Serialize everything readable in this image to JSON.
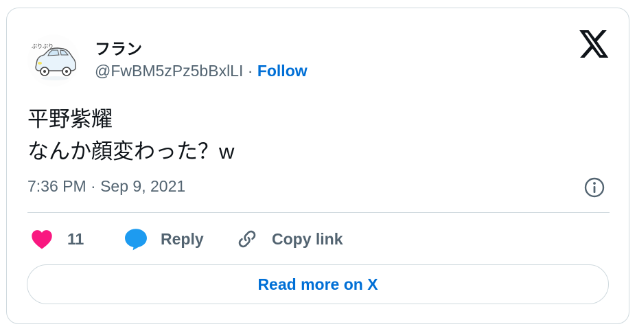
{
  "author": {
    "display_name": "フラン",
    "handle": "@FwBM5zPz5bBxlLI",
    "separator": " · ",
    "follow_label": "Follow",
    "avatar_icon": "car-drawing-avatar",
    "avatar_scribble": "ぷりぷり"
  },
  "tweet": {
    "line1": "平野紫耀",
    "line2": "なんか顔変わった？w",
    "timestamp": "7:36 PM · Sep 9, 2021"
  },
  "actions": {
    "like_count": "11",
    "reply_label": "Reply",
    "copy_label": "Copy link"
  },
  "read_more_label": "Read more on X",
  "icons": {
    "brand": "x-logo-icon",
    "info": "info-icon",
    "like": "heart-icon",
    "reply": "speech-bubble-icon",
    "copy": "link-icon"
  },
  "colors": {
    "like": "#f91880",
    "reply": "#1d9bf0",
    "link": "#006fd6",
    "secondary_text": "#536471",
    "border": "#cfd9de"
  }
}
